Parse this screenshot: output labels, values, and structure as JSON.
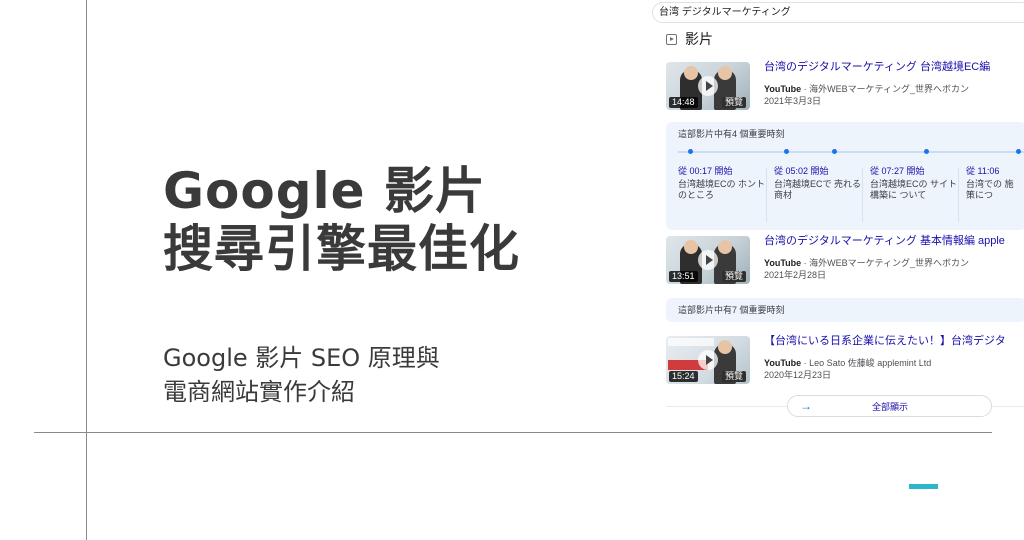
{
  "slide": {
    "title_line1": "Google 影片",
    "title_line2": "搜尋引擎最佳化",
    "subtitle_line1": "Google 影片 SEO 原理與",
    "subtitle_line2": "電商網站實作介紹"
  },
  "colors": {
    "accent": "#2bb7c9",
    "link": "#1a0dab",
    "timeline": "#1a73e8",
    "title_text": "#3a3a3a"
  },
  "search": {
    "query": "台湾 デジタルマーケティング"
  },
  "videos_section": {
    "label": "影片",
    "icon": "video-icon"
  },
  "videos": [
    {
      "title": "台湾のデジタルマーケティング 台湾越境EC編",
      "source": "YouTube",
      "channel": " · 海外WEBマーケティング_世界へボカン",
      "date": "2021年3月3日",
      "duration": "14:48",
      "badge": "預覽"
    },
    {
      "title": "台湾のデジタルマーケティング 基本情報編 apple",
      "source": "YouTube",
      "channel": " · 海外WEBマーケティング_世界へボカン",
      "date": "2021年2月28日",
      "duration": "13:51",
      "badge": "預覽"
    },
    {
      "title": "【台湾にいる日系企業に伝えたい！】台湾デジタ",
      "source": "YouTube",
      "channel": " · Leo Sato 佐藤峻 applemint Ltd",
      "date": "2020年12月23日",
      "duration": "15:24",
      "badge": "預覽"
    }
  ],
  "key_moments_1": {
    "header": "這部影片中有4 個重要時刻",
    "items": [
      {
        "time": "從 00:17 開始",
        "desc": "台湾越境ECの ホントのところ"
      },
      {
        "time": "從 05:02 開始",
        "desc": "台湾越境ECで 売れる商材"
      },
      {
        "time": "從 07:27 開始",
        "desc": "台湾越境ECの サイト構築に ついて"
      },
      {
        "time": "從 11:06",
        "desc": "台湾での 施策につ"
      }
    ]
  },
  "key_moments_2": {
    "header": "這部影片中有7 個重要時刻"
  },
  "show_all": {
    "label": "全部顯示",
    "arrow": "→"
  }
}
